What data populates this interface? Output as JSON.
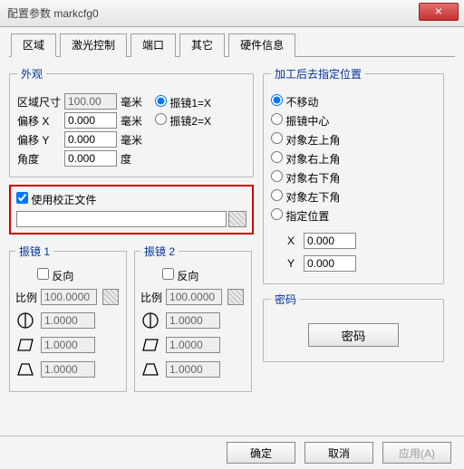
{
  "window": {
    "title": "配置参数 markcfg0"
  },
  "tabs": [
    "区域",
    "激光控制",
    "端口",
    "其它",
    "硬件信息"
  ],
  "appearance": {
    "legend": "外观",
    "size_label": "区域尺寸",
    "size_value": "100.00",
    "size_unit": "毫米",
    "offx_label": "偏移 X",
    "offx_value": "0.000",
    "offx_unit": "毫米",
    "offy_label": "偏移 Y",
    "offy_value": "0.000",
    "offy_unit": "毫米",
    "angle_label": "角度",
    "angle_value": "0.000",
    "angle_unit": "度",
    "galvo1x_label": "振镜1=X",
    "galvo2x_label": "振镜2=X"
  },
  "calib": {
    "checkbox_label": "使用校正文件",
    "file_value": ""
  },
  "galvo1": {
    "legend": "振镜 1",
    "reverse_label": "反向",
    "scale_label": "比例",
    "scale_value": "100.0000",
    "v1": "1.0000",
    "v2": "1.0000",
    "v3": "1.0000"
  },
  "galvo2": {
    "legend": "振镜 2",
    "reverse_label": "反向",
    "scale_label": "比例",
    "scale_value": "100.0000",
    "v1": "1.0000",
    "v2": "1.0000",
    "v3": "1.0000"
  },
  "goto_pos": {
    "legend": "加工后去指定位置",
    "options": [
      "不移动",
      "振镜中心",
      "对象左上角",
      "对象右上角",
      "对象右下角",
      "对象左下角",
      "指定位置"
    ],
    "x_label": "X",
    "x_value": "0.000",
    "y_label": "Y",
    "y_value": "0.000"
  },
  "password": {
    "legend": "密码",
    "button": "密码"
  },
  "buttons": {
    "ok": "确定",
    "cancel": "取消",
    "apply": "应用(A)"
  }
}
